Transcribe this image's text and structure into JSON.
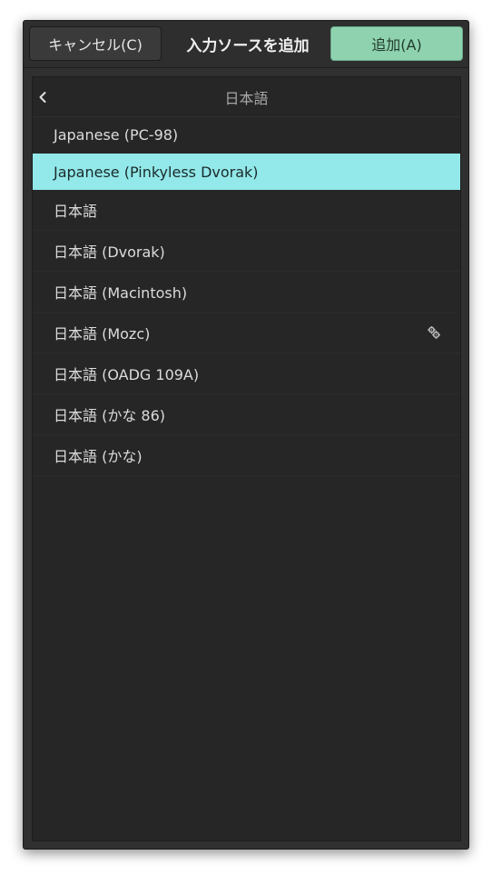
{
  "header": {
    "cancel_label": "キャンセル(C)",
    "title": "入力ソースを追加",
    "add_label": "追加(A)"
  },
  "list": {
    "title": "日本語",
    "back_icon": "chevron-left-icon",
    "items": [
      {
        "label": "Japanese (PC-98)",
        "selected": false,
        "has_settings": false
      },
      {
        "label": "Japanese (Pinkyless Dvorak)",
        "selected": true,
        "has_settings": false
      },
      {
        "label": "日本語",
        "selected": false,
        "has_settings": false
      },
      {
        "label": "日本語 (Dvorak)",
        "selected": false,
        "has_settings": false
      },
      {
        "label": "日本語 (Macintosh)",
        "selected": false,
        "has_settings": false
      },
      {
        "label": "日本語 (Mozc)",
        "selected": false,
        "has_settings": true,
        "settings_icon": "gears-icon"
      },
      {
        "label": "日本語 (OADG 109A)",
        "selected": false,
        "has_settings": false
      },
      {
        "label": "日本語 (かな 86)",
        "selected": false,
        "has_settings": false
      },
      {
        "label": "日本語 (かな)",
        "selected": false,
        "has_settings": false
      }
    ]
  },
  "colors": {
    "selected_row": "#93e8e9",
    "add_button": "#8fd2af",
    "dialog_bg": "#303030",
    "list_bg": "#262626"
  }
}
